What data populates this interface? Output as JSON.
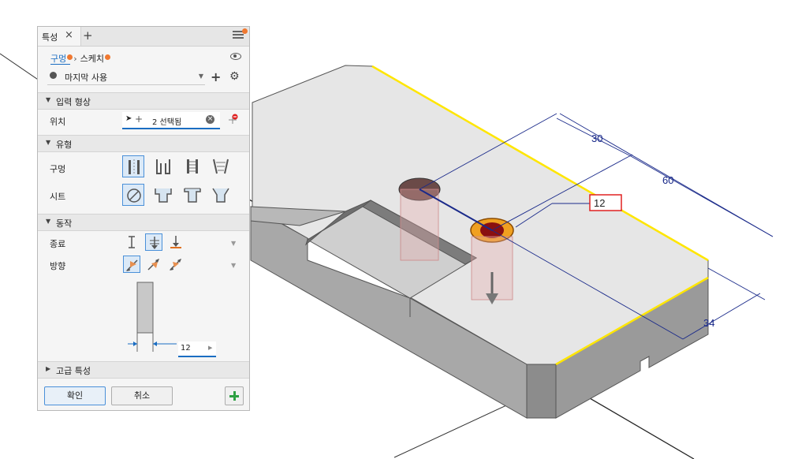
{
  "viewport": {
    "dimensions": {
      "d30": "30",
      "d60": "60",
      "d34": "34"
    },
    "depth_input": "12"
  },
  "panel": {
    "tab_label": "특성",
    "breadcrumb": {
      "hole": "구멍",
      "sketch": "스케치"
    },
    "preset": "마지막 사용",
    "sections": {
      "input": "입력 형상",
      "type": "유형",
      "behavior": "동작",
      "advanced": "고급 특성"
    },
    "labels": {
      "location": "위치",
      "hole": "구멍",
      "seat": "시트",
      "termination": "종료",
      "direction": "방향"
    },
    "location_value": "2 선택됨",
    "depth_value": "12",
    "buttons": {
      "ok": "확인",
      "cancel": "취소"
    }
  },
  "colors": {
    "accent": "#1a6dc2",
    "yellow_edge": "#ffe600",
    "dim_blue": "#1a2a8a",
    "alert_red": "#e02020",
    "add_green": "#2ea043"
  }
}
